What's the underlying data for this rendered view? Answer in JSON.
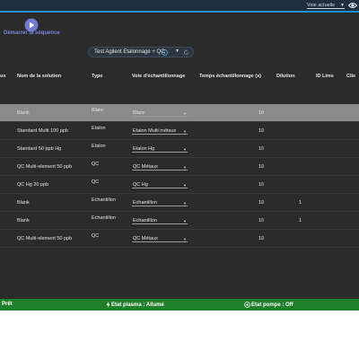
{
  "header": {
    "voie_label": "Voie actuelle",
    "icons": {
      "caret": "chevron-down-icon",
      "eye": "eye-icon"
    },
    "accent": "#1e90d8"
  },
  "toolbar": {
    "play_icon": "play-icon",
    "play_label": "Démarrer la séquence",
    "play_color": "#7a86d8"
  },
  "sequence_selector": {
    "label": "Test Agilent Etalonnage + QC",
    "icons": [
      "info-icon",
      "chevron-down-icon",
      "refresh-icon"
    ]
  },
  "table": {
    "columns": [
      "Nom de la solution",
      "Type",
      "Voie d'échantillonnage",
      "Temps échantillonnage (s)",
      "Dilution",
      "ID Lims",
      "Clie"
    ],
    "left_clip_header": "ux",
    "rows": [
      {
        "name": "Blank",
        "type": "Blanc",
        "voie": "Blanc",
        "time": "10",
        "dilution": "",
        "selected": true
      },
      {
        "name": "Standard Multi 100 ppb",
        "type": "Etalon",
        "voie": "Etalon Multi métaux",
        "time": "10",
        "dilution": "",
        "selected": false
      },
      {
        "name": "Standard 50 ppb Hg",
        "type": "Etalon",
        "voie": "Etalon Hg",
        "time": "10",
        "dilution": "",
        "selected": false
      },
      {
        "name": "QC Multi-element 50 ppb",
        "type": "QC",
        "voie": "QC Métaux",
        "time": "10",
        "dilution": "",
        "selected": false
      },
      {
        "name": "QC Hg 20 ppb",
        "type": "QC",
        "voie": "QC Hg",
        "time": "10",
        "dilution": "",
        "selected": false
      },
      {
        "name": "Blank",
        "type": "Echantillon",
        "voie": "Echantillon",
        "time": "10",
        "dilution": "1",
        "selected": false
      },
      {
        "name": "Blank",
        "type": "Echantillon",
        "voie": "Echantillon",
        "time": "10",
        "dilution": "1",
        "selected": false
      },
      {
        "name": "QC Multi-element 50 ppb",
        "type": "QC",
        "voie": "QC Métaux",
        "time": "10",
        "dilution": "",
        "selected": false
      }
    ]
  },
  "status": {
    "pret": "Prêt",
    "plasma": "Etat plasma : Allumé",
    "pompe": "Etat pompe : Off",
    "icons": {
      "plasma": "lightning-icon",
      "pompe": "pump-icon"
    },
    "color": "#1f7f2a"
  }
}
